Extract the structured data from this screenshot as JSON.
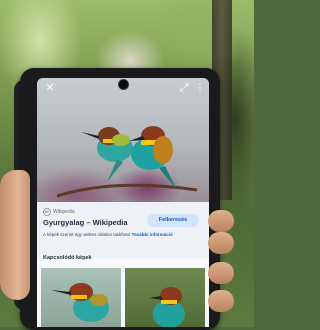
{
  "lens_result": {
    "source_label": "Wikipedia",
    "title": "Gyurgyalag – Wikipedia",
    "visit_button": "Felkeresés",
    "description_text": "A képek szerint egy webes oldalon található",
    "description_link": "További információ",
    "section_heading": "Kapcsolódó képek"
  },
  "icons": [
    "close-icon",
    "expand-icon",
    "more-icon",
    "camera-icon"
  ],
  "colors": {
    "accent": "#1a57c0",
    "button_bg": "#d2e3fc",
    "screen_bg": "#f6f8fb"
  }
}
